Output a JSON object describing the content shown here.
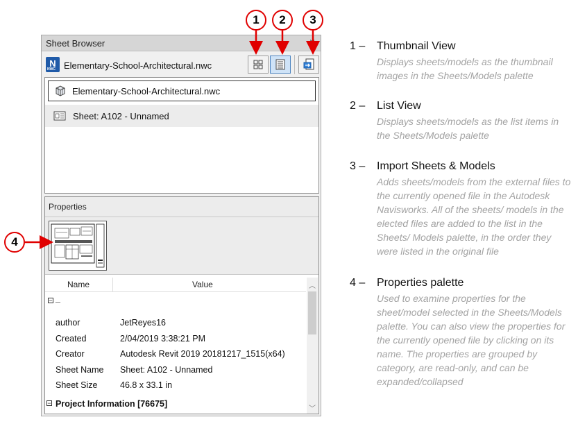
{
  "window": {
    "title": "Sheet Browser",
    "close_glyph": "×",
    "file_name": "Elementary-School-Architectural.nwc",
    "file_icon_letter": "N",
    "file_icon_sub": "NWC"
  },
  "toolbar": {
    "thumbnail_icon": "thumbnail-grid-icon",
    "list_icon": "list-view-icon",
    "import_icon": "import-sheets-icon",
    "active": "list"
  },
  "list": {
    "items": [
      {
        "label": "Elementary-School-Architectural.nwc",
        "icon": "model-icon"
      },
      {
        "label": "Sheet: A102 - Unnamed",
        "icon": "sheet-icon"
      }
    ]
  },
  "properties": {
    "header": "Properties",
    "columns": {
      "name": "Name",
      "value": "Value"
    },
    "groups": [
      {
        "label": "_"
      },
      {
        "label": "Project Information [76675]"
      }
    ],
    "rows": [
      {
        "name": "author",
        "value": "JetReyes16"
      },
      {
        "name": "Created",
        "value": "2/04/2019 3:38:21 PM"
      },
      {
        "name": "Creator",
        "value": "Autodesk Revit 2019 20181217_1515(x64)"
      },
      {
        "name": "Sheet Name",
        "value": "Sheet: A102 - Unnamed"
      },
      {
        "name": "Sheet Size",
        "value": "46.8 x 33.1 in"
      }
    ]
  },
  "callouts": [
    "1",
    "2",
    "3",
    "4"
  ],
  "descriptions": [
    {
      "num": "1 –",
      "title": "Thumbnail View",
      "text": "Displays sheets/models as the thumbnail images in the Sheets/Models palette"
    },
    {
      "num": "2 –",
      "title": "List View",
      "text": "Displays sheets/models as the list items in the Sheets/Models palette"
    },
    {
      "num": "3 –",
      "title": "Import Sheets & Models",
      "text": "Adds sheets/models from the external files to the currently opened file in the Autodesk Navisworks. All of the sheets/ models in the elected files are added to the list in the Sheets/ Models palette, in the order they were listed in the original file"
    },
    {
      "num": "4 –",
      "title": "Properties palette",
      "text": "Used to examine properties for the sheet/model selected in the Sheets/Models palette. You can also view the properties for the currently opened file by clicking on its name. The properties are grouped by category, are read-only, and can be expanded/collapsed"
    }
  ],
  "colors": {
    "callout_red": "#e00000",
    "active_button": "#cfe3f7",
    "description_gray": "#a3a3a3"
  }
}
